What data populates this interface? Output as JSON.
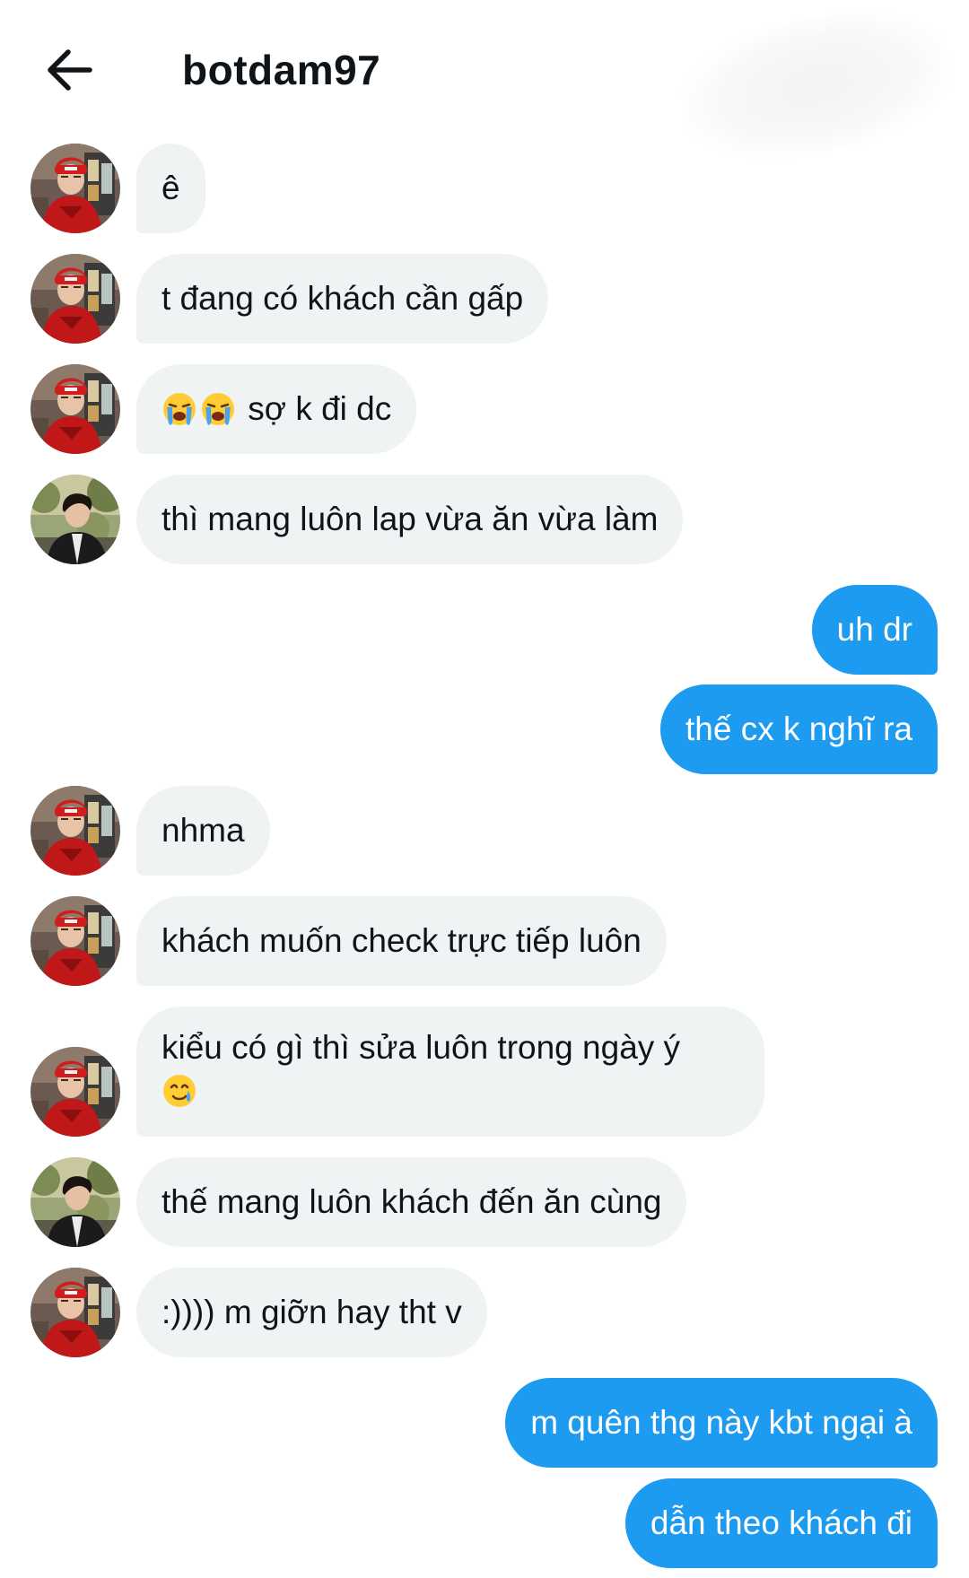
{
  "header": {
    "title": "botdam97",
    "back_icon": "arrow-left-icon"
  },
  "colors": {
    "incoming_bubble": "#eff3f4",
    "outgoing_bubble": "#1d9bf0",
    "text": "#0f1419"
  },
  "messages": [
    {
      "direction": "in",
      "sender_avatar": "avatar-red-jacket",
      "text": "ê"
    },
    {
      "direction": "in",
      "sender_avatar": "avatar-red-jacket",
      "text": "t đang có khách cần gấp"
    },
    {
      "direction": "in",
      "sender_avatar": "avatar-red-jacket",
      "emoji": "loudly-crying-face-icon",
      "text": "sợ k đi dc"
    },
    {
      "direction": "in",
      "sender_avatar": "avatar-outdoor",
      "text": "thì mang luôn lap vừa ăn vừa làm"
    },
    {
      "direction": "out",
      "text": "uh dr"
    },
    {
      "direction": "out",
      "text": "thế cx k nghĩ ra"
    },
    {
      "direction": "in",
      "sender_avatar": "avatar-red-jacket",
      "text": "nhma"
    },
    {
      "direction": "in",
      "sender_avatar": "avatar-red-jacket",
      "text": "khách muốn check trực tiếp luôn"
    },
    {
      "direction": "in",
      "sender_avatar": "avatar-red-jacket",
      "text": "kiểu có gì thì sửa luôn trong ngày ý",
      "emoji": "smiling-face-with-tear-icon"
    },
    {
      "direction": "in",
      "sender_avatar": "avatar-outdoor",
      "text": "thế mang luôn khách đến ăn cùng"
    },
    {
      "direction": "in",
      "sender_avatar": "avatar-red-jacket",
      "text": ":)))) m giỡn hay tht v"
    },
    {
      "direction": "out",
      "text": "m quên thg này kbt ngại à"
    },
    {
      "direction": "out",
      "text": "dẫn theo khách đi"
    }
  ]
}
